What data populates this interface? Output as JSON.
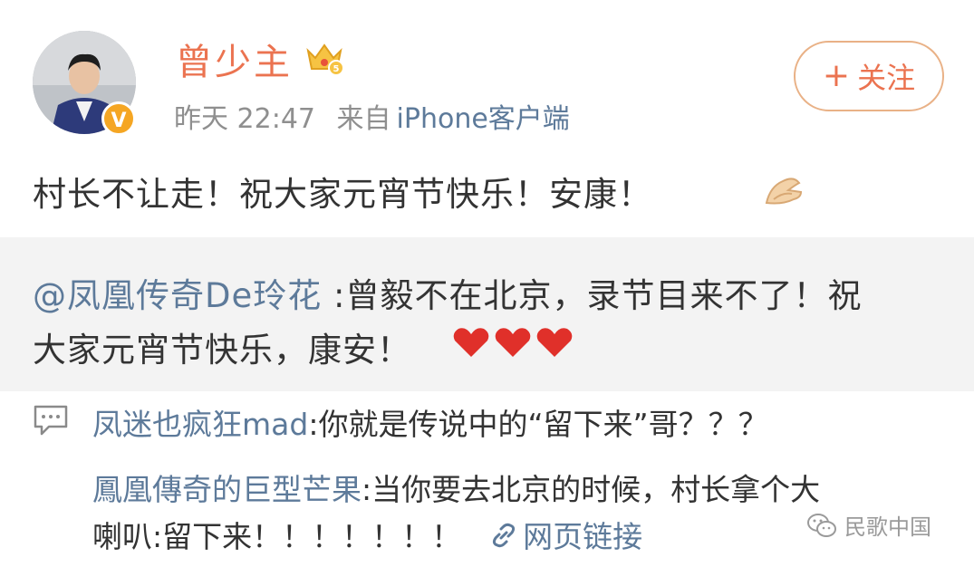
{
  "user": {
    "name": "曾少主",
    "time": "昨天 22:47",
    "source_prefix": "来自",
    "source": "iPhone客户端",
    "verified_icon": "verified-v-icon",
    "crown_icon": "crown-badge-icon"
  },
  "actions": {
    "follow_label": "关注",
    "follow_icon": "plus-icon"
  },
  "post": {
    "text": "村长不让走！祝大家元宵节快乐！安康！",
    "emoji": "hands-together-emoji"
  },
  "repost": {
    "mention": "@凤凰传奇De玲花",
    "line1_text": " :曾毅不在北京，录节目来不了！祝",
    "line2_text": "大家元宵节快乐，康安！",
    "emoji": "red-hearts-emoji"
  },
  "comments": [
    {
      "author": "凤迷也疯狂mad",
      "text": ":你就是传说中的“留下来”哥？？？"
    },
    {
      "author": "鳳凰傳奇的巨型芒果",
      "text": ":当你要去北京的时候，村长拿个大",
      "text2": "喇叭:留下来！！！！！！！",
      "link": "网页链接"
    }
  ],
  "watermark": {
    "text": "民歌中国",
    "icon": "wechat-icon"
  },
  "colors": {
    "accent": "#eb7350",
    "link": "#5d7a9a",
    "meta": "#8f8f8f",
    "repost_bg": "#f3f3f3"
  }
}
